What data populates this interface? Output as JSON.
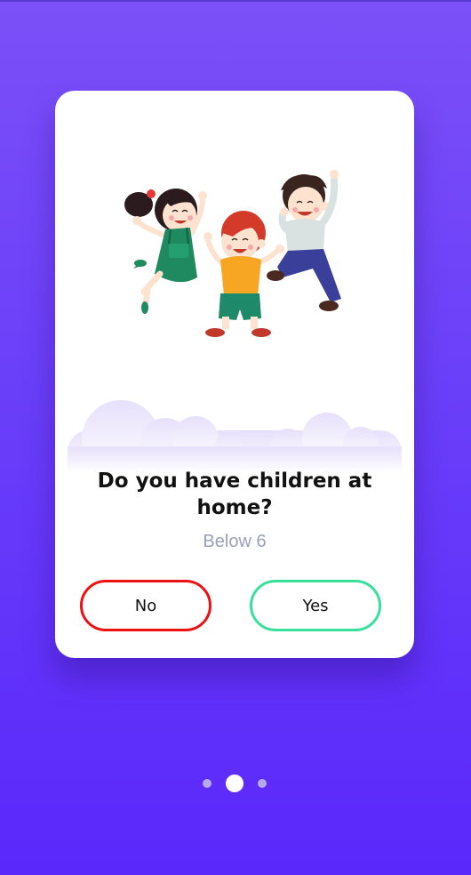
{
  "card": {
    "question": "Do you have children at home?",
    "subtitle": "Below 6",
    "no_label": "No",
    "yes_label": "Yes"
  },
  "pagination": {
    "total_pages": 3,
    "current_page": 2
  },
  "colors": {
    "background_top": "#7b50f8",
    "background_bottom": "#5a28fb",
    "no_border": "#ee1111",
    "yes_border": "#37e09c",
    "subtitle": "#9aa0b6"
  },
  "illustration": {
    "icon": "jumping-children-illustration"
  }
}
